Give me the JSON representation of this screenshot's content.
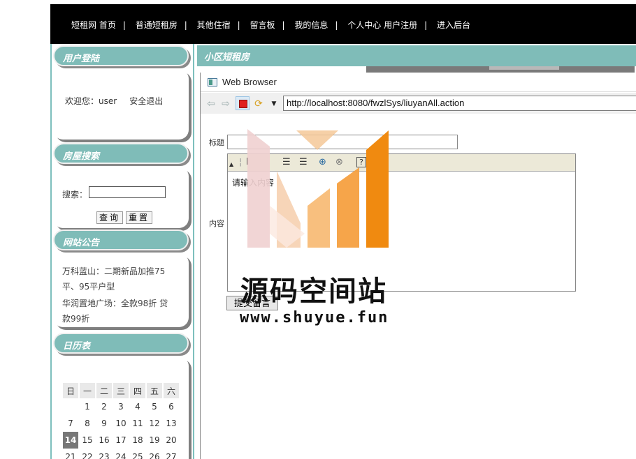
{
  "nav": {
    "items": [
      "短租网 首页",
      "普通短租房",
      "其他住宿",
      "留言板",
      "我的信息",
      "个人中心 用户注册",
      "进入后台"
    ],
    "separator": "|"
  },
  "login": {
    "title": "用户登陆",
    "welcome": "欢迎您：user",
    "logout": "安全退出"
  },
  "search": {
    "title": "房屋搜索",
    "label": "搜索：",
    "value": "",
    "query_button": "查询",
    "reset_button": "重置"
  },
  "notice": {
    "title": "网站公告",
    "items": [
      "万科蓝山：二期新品加推75平、95平户型",
      "华润置地广场：全款98折 贷款99折"
    ]
  },
  "calendar": {
    "title": "日历表",
    "weekdays": [
      "日",
      "一",
      "二",
      "三",
      "四",
      "五",
      "六"
    ],
    "weeks": [
      [
        "",
        "1",
        "2",
        "3",
        "4",
        "5",
        "6"
      ],
      [
        "7",
        "8",
        "9",
        "10",
        "11",
        "12",
        "13"
      ],
      [
        "14",
        "15",
        "16",
        "17",
        "18",
        "19",
        "20"
      ],
      [
        "21",
        "22",
        "23",
        "24",
        "25",
        "26",
        "27"
      ]
    ],
    "today": "14"
  },
  "main": {
    "title": "小区短租房"
  },
  "browser": {
    "title": "Web Browser",
    "url": "http://localhost:8080/fwzlSys/liuyanAll.action"
  },
  "form": {
    "title_label": "标题",
    "title_value": "",
    "content_label": "内容",
    "content_placeholder": "请输入内容",
    "submit_label": "提交留言"
  },
  "watermark": {
    "name": "源码空间站",
    "url": "www.shuyue.fun",
    "colors": [
      "#f0c8c8",
      "#f7b880",
      "#f5a040",
      "#f08a10"
    ]
  }
}
